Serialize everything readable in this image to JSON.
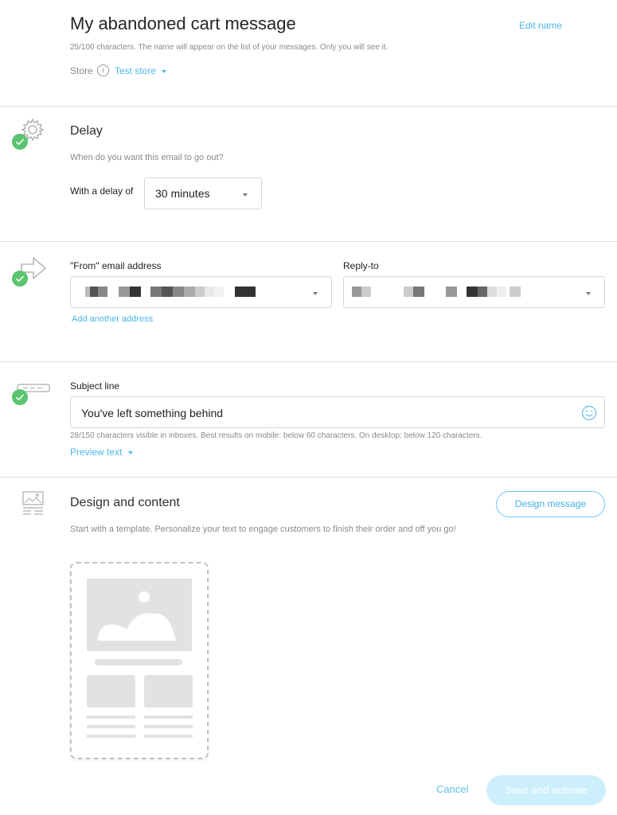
{
  "header": {
    "title": "My abandoned cart message",
    "edit_name": "Edit name",
    "name_hint": "25/100 characters. The name will appear on the list of your messages. Only you will see it.",
    "store_label": "Store",
    "store_value": "Test store"
  },
  "delay": {
    "title": "Delay",
    "question": "When do you want this email to go out?",
    "delay_label": "With a delay of",
    "delay_value": "30 minutes"
  },
  "from": {
    "from_label": "\"From\" email address",
    "reply_label": "Reply-to",
    "add_another": "Add another address"
  },
  "subject": {
    "label": "Subject line",
    "value": "You've left something behind",
    "hint": "28/150 characters visible in inboxes. Best results on mobile: below 60 characters. On desktop: below 120 characters.",
    "preview_text": "Preview text"
  },
  "design": {
    "title": "Design and content",
    "button": "Design message",
    "description": "Start with a template. Personalize your text to engage customers to finish their order and off you go!"
  },
  "footer": {
    "cancel": "Cancel",
    "save": "Save and activate"
  },
  "colors": {
    "accent": "#4cb8e8",
    "success": "#5ac46e",
    "disabled_button": "#cdeffc"
  },
  "icons": {
    "delay": "gear-icon",
    "from": "arrow-icon",
    "subject": "subject-bar-icon",
    "design": "layout-icon",
    "emoji": "emoji-icon",
    "info": "info-icon"
  }
}
